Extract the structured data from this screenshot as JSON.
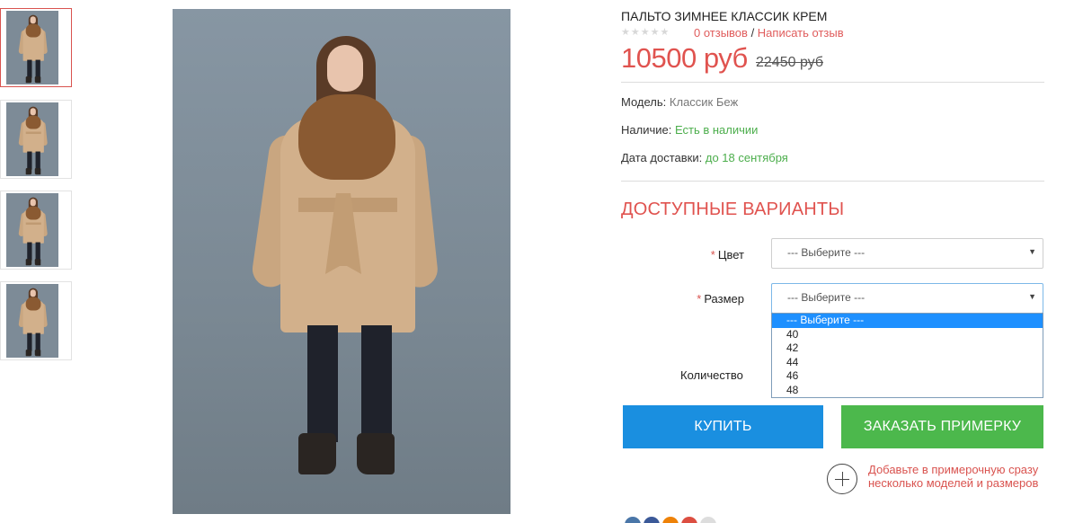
{
  "product": {
    "title": "ПАЛЬТО ЗИМНЕЕ КЛАССИК КРЕМ",
    "stars": "★★★★★",
    "reviews_link": "0 отзывов",
    "reviews_sep": " / ",
    "write_review_link": "Написать отзыв",
    "price": "10500 руб",
    "old_price": "22450 руб"
  },
  "meta": {
    "model_label": "Модель:",
    "model_value": "Классик Беж",
    "availability_label": "Наличие:",
    "availability_value": "Есть в наличии",
    "delivery_label": "Дата доставки:",
    "delivery_value": "до 18 сентября"
  },
  "options": {
    "section_title": "ДОСТУПНЫЕ ВАРИАНТЫ",
    "required_mark": "*",
    "color_label": "Цвет",
    "color_value": "--- Выберите ---",
    "size_label": "Размер",
    "size_value": "--- Выберите ---",
    "size_options": [
      "--- Выберите ---",
      "40",
      "42",
      "44",
      "46",
      "48"
    ],
    "quantity_label": "Количество"
  },
  "actions": {
    "buy_label": "КУПИТЬ",
    "fitting_label": "ЗАКАЗАТЬ ПРИМЕРКУ",
    "promo_text": "Добавьте в примерочную сразу несколько моделей и размеров"
  },
  "gallery": {
    "thumbnail_count": 4,
    "active_index": 0
  },
  "colors": {
    "accent_red": "#e0534f",
    "green": "#4cae4c",
    "buy_blue": "#1a8fe0",
    "fitting_green": "#4cb84c",
    "dropdown_highlight": "#1e90ff"
  },
  "social_icons": [
    "vk-icon",
    "facebook-icon",
    "odnoklassniki-icon",
    "google-plus-icon",
    "share-icon"
  ]
}
